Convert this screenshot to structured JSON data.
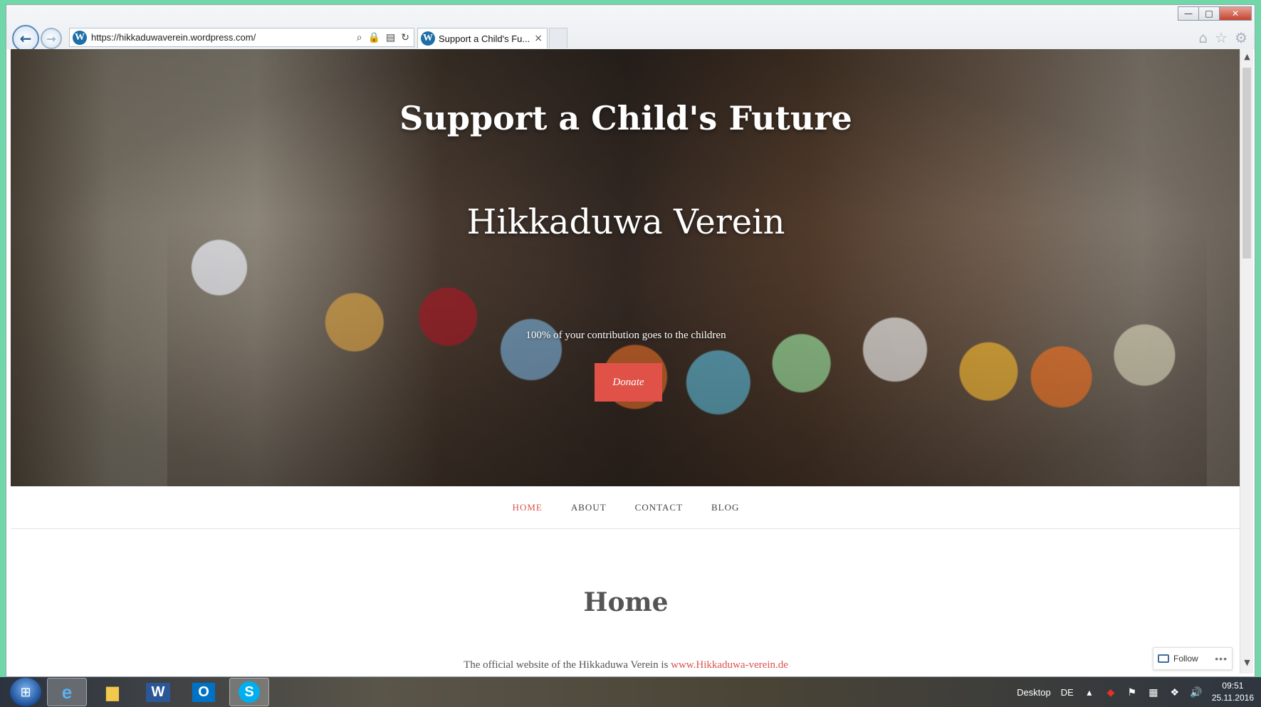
{
  "browser": {
    "url": "https://hikkaduwaverein.wordpress.com/",
    "tab_title": "Support a Child's Fu...",
    "tab_close": "×",
    "window_controls": {
      "minimize": "—",
      "maximize": "□",
      "close": "✕"
    },
    "icons": [
      "back-icon",
      "forward-icon",
      "search-icon",
      "lock-icon",
      "compat-icon",
      "refresh-icon",
      "home-icon",
      "star-icon",
      "gear-icon"
    ]
  },
  "hero": {
    "title": "Support a Child's Future",
    "subtitle": "Hikkaduwa Verein",
    "tagline": "100% of your contribution goes to the children",
    "donate_label": "Donate"
  },
  "nav": {
    "items": [
      {
        "label": "HOME",
        "active": true
      },
      {
        "label": "ABOUT",
        "active": false
      },
      {
        "label": "CONTACT",
        "active": false
      },
      {
        "label": "BLOG",
        "active": false
      }
    ]
  },
  "content": {
    "heading": "Home",
    "intro_text": "The official website of the Hikkaduwa Verein is ",
    "intro_link": "www.Hikkaduwa-verein.de"
  },
  "follow": {
    "label": "Follow",
    "more": "•••"
  },
  "taskbar": {
    "apps": [
      "ie-icon",
      "explorer-icon",
      "word-icon",
      "outlook-icon",
      "skype-icon"
    ],
    "desktop_label": "Desktop",
    "language": "DE",
    "time": "09:51",
    "date": "25.11.2016"
  },
  "colors": {
    "accent": "#e05148",
    "nav_active": "#d9534f",
    "text": "#555555"
  }
}
